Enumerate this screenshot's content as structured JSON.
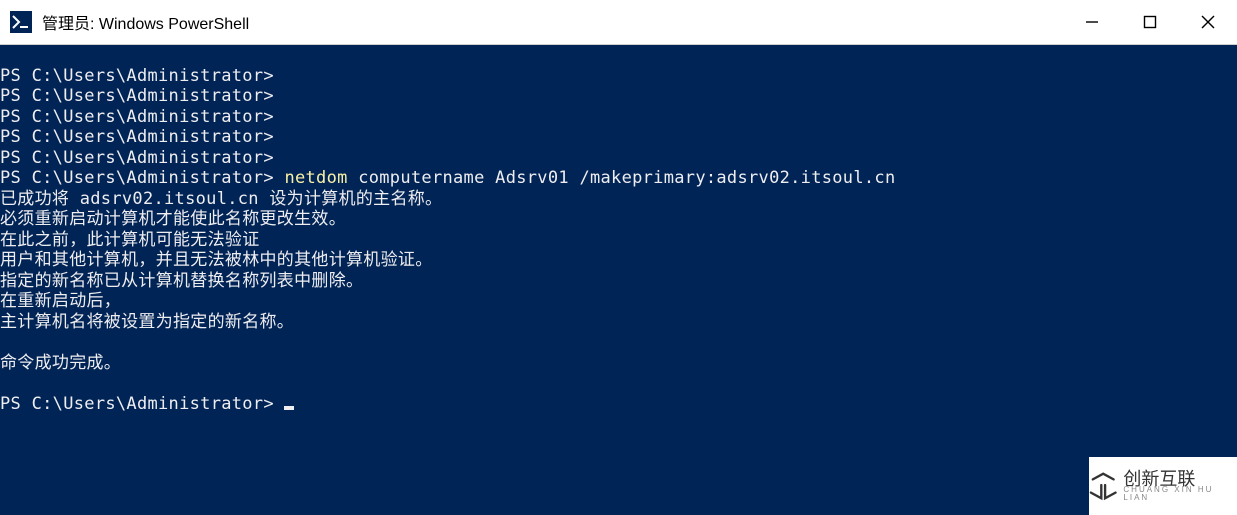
{
  "window": {
    "title": "管理员: Windows PowerShell",
    "icon_label": "powershell-icon",
    "icon_glyph": "∑_"
  },
  "prompt": "PS C:\\Users\\Administrator>",
  "command": {
    "exe": "netdom",
    "args": " computername Adsrv01 /makeprimary:adsrv02.itsoul.cn"
  },
  "output": {
    "l1": "已成功将 adsrv02.itsoul.cn 设为计算机的主名称。",
    "l2": "必须重新启动计算机才能使此名称更改生效。",
    "l3": "在此之前，此计算机可能无法验证",
    "l4": "用户和其他计算机，并且无法被林中的其他计算机验证。",
    "l5": "指定的新名称已从计算机替换名称列表中删除。",
    "l6": "在重新启动后，",
    "l7": "主计算机名将被设置为指定的新名称。",
    "blank": "",
    "l8": "命令成功完成。"
  },
  "watermark": {
    "main": "创新互联",
    "sub": "CHUANG XIN HU LIAN"
  }
}
